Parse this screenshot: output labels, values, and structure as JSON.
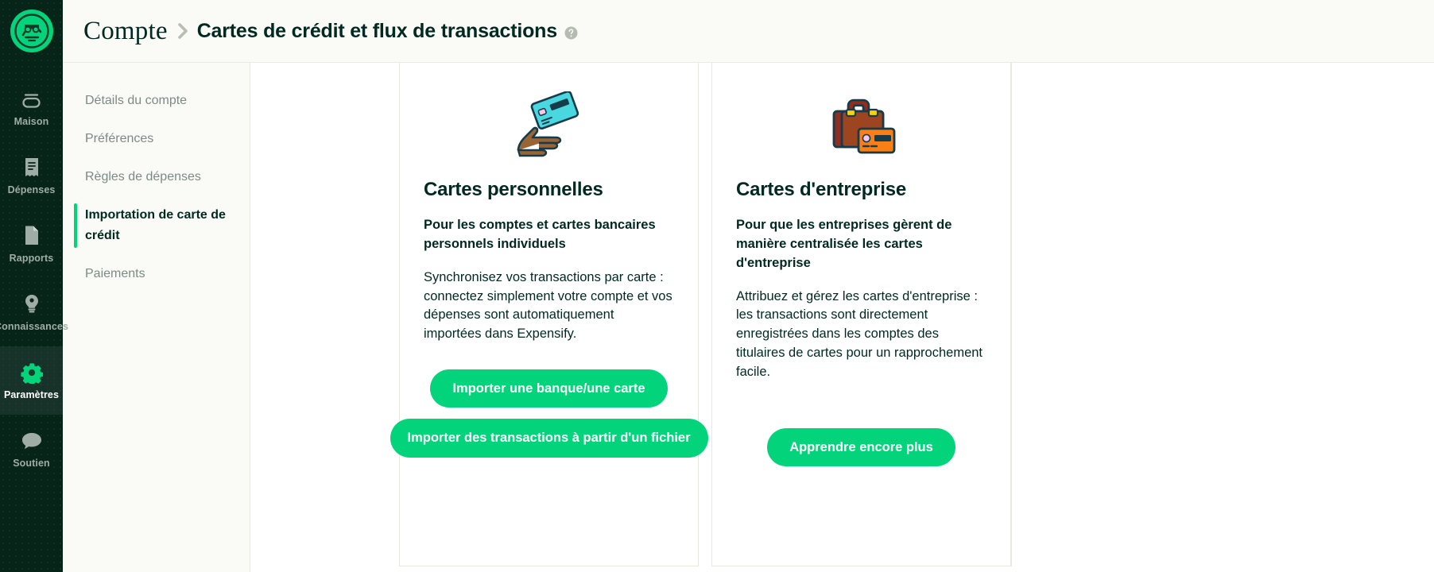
{
  "rail": {
    "logo_icon": "expensify-logo-icon",
    "items": [
      {
        "label": "Maison",
        "icon": "home-icon",
        "active": false
      },
      {
        "label": "Dépenses",
        "icon": "receipt-icon",
        "active": false
      },
      {
        "label": "Rapports",
        "icon": "document-icon",
        "active": false
      },
      {
        "label": "Connaissances",
        "icon": "lightbulb-icon",
        "active": false
      },
      {
        "label": "Paramètres",
        "icon": "gear-icon",
        "active": true
      },
      {
        "label": "Soutien",
        "icon": "chat-bubble-icon",
        "active": false
      }
    ]
  },
  "header": {
    "breadcrumb_root": "Compte",
    "breadcrumb_separator_icon": "chevron-right-icon",
    "breadcrumb_current": "Cartes de crédit et flux de transactions",
    "help_icon": "help-circle-icon"
  },
  "subnav": {
    "items": [
      {
        "label": "Détails du compte",
        "active": false
      },
      {
        "label": "Préférences",
        "active": false
      },
      {
        "label": "Règles de dépenses",
        "active": false
      },
      {
        "label": "Importation de carte de crédit",
        "active": true
      },
      {
        "label": "Paiements",
        "active": false
      }
    ]
  },
  "cards": [
    {
      "art_icon": "hand-holding-credit-card-icon",
      "title": "Cartes personnelles",
      "lead": "Pour les comptes et cartes bancaires personnels individuels",
      "body": "Synchronisez vos transactions par carte : connectez simplement votre compte et vos dépenses sont automatiquement importées dans Expensify.",
      "buttons": [
        "Importer une banque/une carte",
        "Importer des transactions à partir d'un fichier"
      ]
    },
    {
      "art_icon": "briefcase-with-credit-card-icon",
      "title": "Cartes d'entreprise",
      "lead": "Pour que les entreprises gèrent de manière centralisée les cartes d'entreprise",
      "body": "Attribuez et gérez les cartes d'entreprise : les transactions sont directement enregistrées dans les comptes des titulaires de cartes pour un rapprochement facile.",
      "buttons": [
        "Apprendre encore plus"
      ]
    }
  ],
  "colors": {
    "brand_green": "#03d47c",
    "rail_dark": "#072419",
    "ink": "#002921",
    "panel": "#fafaf6",
    "hairline": "#e9e8e0",
    "muted_text": "#7d8b86"
  }
}
